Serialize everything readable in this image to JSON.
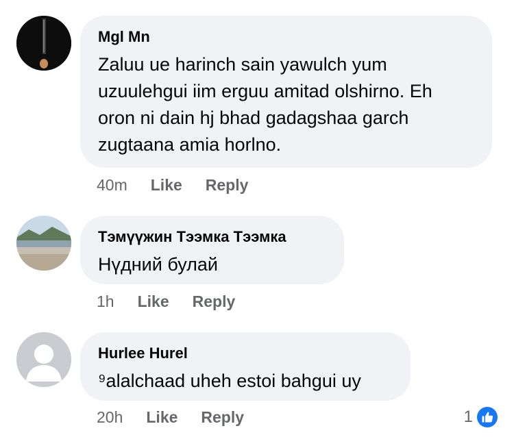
{
  "comments": [
    {
      "author": "Mgl Mn",
      "text": "Zaluu ue harinch sain yawulch yum\nuzuulehgui iim erguu amitad olshirno. Eh\noron ni dain hj bhad gadagshaa garch\nzugtaana amia horlno.",
      "time": "40m",
      "like_label": "Like",
      "reply_label": "Reply"
    },
    {
      "author": "Тэмүүжин Тээмка Тээмка",
      "text": "Нүдний булай",
      "time": "1h",
      "like_label": "Like",
      "reply_label": "Reply"
    },
    {
      "author": "Hurlee Hurel",
      "text": "⁹alalchaad uheh estoi bahgui uy",
      "time": "20h",
      "like_label": "Like",
      "reply_label": "Reply",
      "reaction_count": "1",
      "reaction_icon": "thumbs-up-icon"
    }
  ],
  "colors": {
    "bubble": "#f0f2f5",
    "meta_text": "#65676b",
    "like_blue": "#1877f2"
  }
}
